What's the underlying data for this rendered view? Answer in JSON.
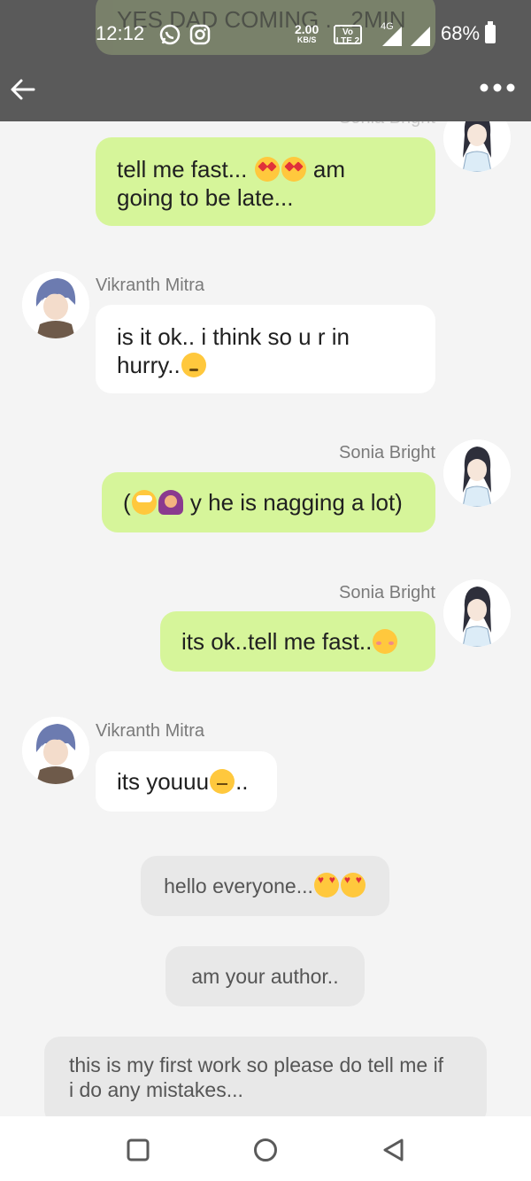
{
  "status_bar": {
    "time": "12:12",
    "speed_value": "2.00",
    "speed_unit": "KB/S",
    "volte_top": "Vo",
    "volte_bottom": "LTE 2",
    "network": "4G",
    "battery": "68%",
    "icons": [
      "whatsapp-icon",
      "instagram-icon",
      "signal-icon",
      "battery-icon"
    ]
  },
  "app_bar": {
    "back_icon": "arrow-left-icon",
    "menu_icon": "more-horizontal-icon",
    "faded_top_text": "YES DAD COMING ... 2MIN",
    "faded_sender": "Sonia Bright"
  },
  "messages": [
    {
      "side": "right",
      "sender": "",
      "text_parts": [
        "tell me fast...",
        "am"
      ],
      "text_line2": "going to be late..."
    },
    {
      "side": "left",
      "sender": "Vikranth Mitra",
      "line1": "is it ok.. i think so u r in",
      "line2": "hurry.."
    },
    {
      "side": "right",
      "sender": "Sonia Bright",
      "text_open": "(",
      "text": " y he is nagging a lot)"
    },
    {
      "side": "right",
      "sender": "Sonia Bright",
      "text": "its ok..tell me fast.."
    },
    {
      "side": "left",
      "sender": "Vikranth Mitra",
      "text": "its youuu",
      "text_after": ".."
    }
  ],
  "system_messages": [
    {
      "text": "hello everyone..."
    },
    {
      "text": "am your author.."
    },
    {
      "line1": "this is my first work so please do tell me if",
      "line2": "i do any mistakes..."
    }
  ],
  "nav_bar": {
    "icons": [
      "recent-apps-icon",
      "home-icon",
      "back-triangle-icon"
    ]
  },
  "colors": {
    "status_bar": "#5a5a5a",
    "right_bubble": "#d6f59a",
    "left_bubble": "#ffffff",
    "system_bubble": "#e8e8e8",
    "chat_background": "#f4f4f4"
  }
}
